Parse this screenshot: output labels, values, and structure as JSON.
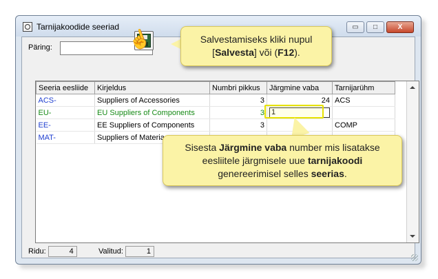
{
  "window": {
    "title": "Tarnijakoodide seeriad",
    "minimize_icon": "minimize-icon",
    "maximize_icon": "maximize-icon",
    "close_icon": "close-icon",
    "min_label": "▭",
    "max_label": "□",
    "close_label": "X"
  },
  "query": {
    "label": "Päring:",
    "value": ""
  },
  "save": {
    "icon": "floppy-disk-icon"
  },
  "table": {
    "columns": [
      "Seeria eesliide",
      "Kirjeldus",
      "Numbri pikkus",
      "Järgmine vaba",
      "Tarnijarühm"
    ],
    "rows": [
      {
        "prefix": "ACS-",
        "description": "Suppliers of Accessories",
        "length": "3",
        "next": "24",
        "group": "ACS"
      },
      {
        "prefix": "EU-",
        "description": "EU Suppliers of Components",
        "length": "3",
        "next": "1",
        "group": ""
      },
      {
        "prefix": "EE-",
        "description": "EE Suppliers of Components",
        "length": "3",
        "next": "",
        "group": "COMP"
      },
      {
        "prefix": "MAT-",
        "description": "Suppliers of Materia",
        "length": "",
        "next": "",
        "group": ""
      }
    ]
  },
  "status": {
    "rows_label": "Ridu:",
    "rows_value": "4",
    "selected_label": "Valitud:",
    "selected_value": "1"
  },
  "callout_save": {
    "line1": "Salvestamiseks kliki nupul",
    "pre": "[",
    "button": "Salvesta",
    "mid": "] või (",
    "key": "F12",
    "post": ")."
  },
  "callout_next": {
    "t1": "Sisesta ",
    "b1": "Järgmine vaba",
    "t2": " number mis lisatakse",
    "t3": "eesliitele järgmisele uue ",
    "b2": "tarnijakoodi",
    "t4": "genereerimisel selles ",
    "b3": "seerias",
    "t5": "."
  },
  "colors": {
    "accent_code": "#1f3fd0",
    "active_row": "#168a16",
    "callout_bg": "#fbf3a6",
    "highlight": "#e7e200"
  }
}
